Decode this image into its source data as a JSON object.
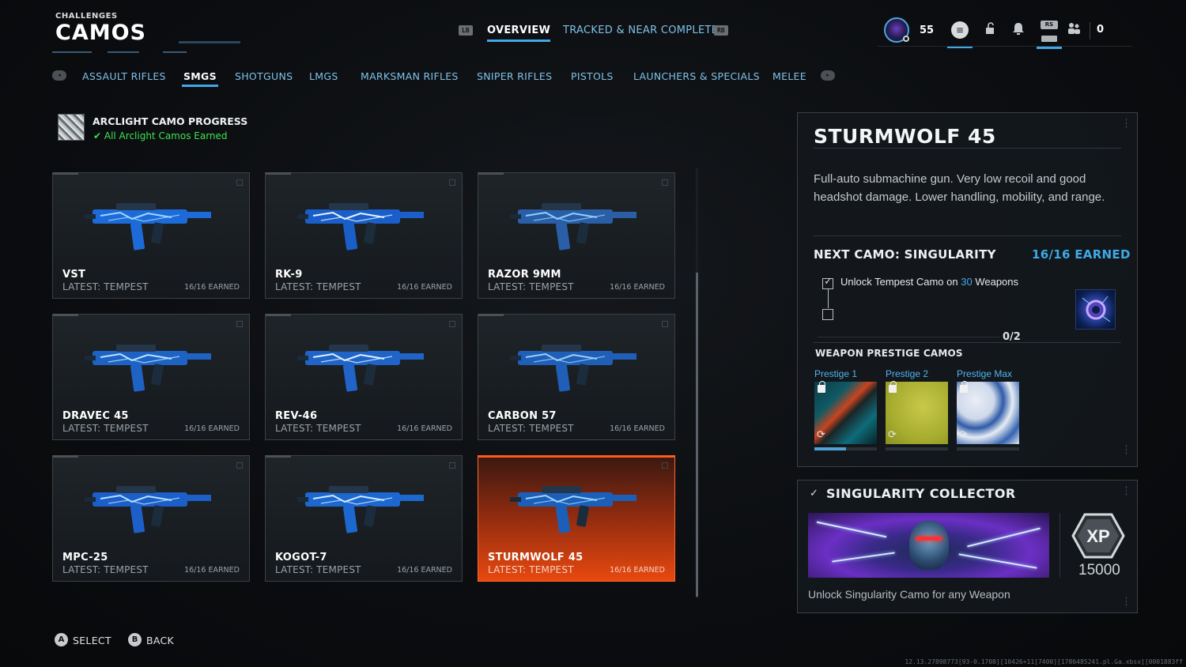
{
  "header": {
    "section": "CHALLENGES",
    "title": "CAMOS",
    "tabs": [
      {
        "label": "OVERVIEW",
        "active": true
      },
      {
        "label": "TRACKED & NEAR COMPLETE",
        "active": false
      }
    ],
    "lb_hint": "LB",
    "rb_hint": "RB",
    "player_level": "55",
    "rs_hint": "RS",
    "notification_count": "0"
  },
  "categories": {
    "items": [
      {
        "label": "ASSAULT RIFLES",
        "active": false
      },
      {
        "label": "SMGS",
        "active": true
      },
      {
        "label": "SHOTGUNS",
        "active": false
      },
      {
        "label": "LMGS",
        "active": false
      },
      {
        "label": "MARKSMAN RIFLES",
        "active": false
      },
      {
        "label": "SNIPER RIFLES",
        "active": false
      },
      {
        "label": "PISTOLS",
        "active": false
      },
      {
        "label": "LAUNCHERS & SPECIALS",
        "active": false
      },
      {
        "label": "MELEE",
        "active": false
      }
    ],
    "left_bumper": "LS",
    "right_bumper": "RS"
  },
  "arclight": {
    "title": "ARCLIGHT CAMO PROGRESS",
    "status": "✔ All Arclight Camos Earned"
  },
  "weapons": [
    {
      "name": "VST",
      "latest": "LATEST: TEMPEST",
      "earned": "16/16 EARNED"
    },
    {
      "name": "RK-9",
      "latest": "LATEST: TEMPEST",
      "earned": "16/16 EARNED"
    },
    {
      "name": "RAZOR 9MM",
      "latest": "LATEST: TEMPEST",
      "earned": "16/16 EARNED"
    },
    {
      "name": "DRAVEC 45",
      "latest": "LATEST: TEMPEST",
      "earned": "16/16 EARNED"
    },
    {
      "name": "REV-46",
      "latest": "LATEST: TEMPEST",
      "earned": "16/16 EARNED"
    },
    {
      "name": "CARBON 57",
      "latest": "LATEST: TEMPEST",
      "earned": "16/16 EARNED"
    },
    {
      "name": "MPC-25",
      "latest": "LATEST: TEMPEST",
      "earned": "16/16 EARNED"
    },
    {
      "name": "KOGOT-7",
      "latest": "LATEST: TEMPEST",
      "earned": "16/16 EARNED"
    },
    {
      "name": "STURMWOLF 45",
      "latest": "LATEST: TEMPEST",
      "earned": "16/16 EARNED"
    }
  ],
  "selected_weapon": "STURMWOLF 45",
  "detail": {
    "title": "STURMWOLF 45",
    "description": "Full-auto submachine gun. Very low recoil and good headshot damage. Lower handling, mobility, and range.",
    "next_camo_label": "NEXT CAMO: SINGULARITY",
    "next_camo_earned": "16/16 EARNED",
    "task_prefix": "Unlock Tempest Camo on",
    "task_number": "30",
    "task_suffix": "Weapons",
    "task_progress": "0/2",
    "prestige_heading": "WEAPON PRESTIGE CAMOS",
    "prestige": [
      {
        "label": "Prestige 1",
        "progress": 0.5
      },
      {
        "label": "Prestige 2",
        "progress": 0
      },
      {
        "label": "Prestige Max",
        "progress": 0
      }
    ]
  },
  "collector": {
    "title": "SINGULARITY COLLECTOR",
    "xp_badge": "XP",
    "xp_amount": "15000",
    "description": "Unlock Singularity Camo for any Weapon"
  },
  "footer": {
    "select_key": "A",
    "select_label": "SELECT",
    "back_key": "B",
    "back_label": "BACK",
    "build": "12.13.27898773[93-0.1708][10426+11[7400][1786485241.pl.Ga.xbsx][0001883ff"
  },
  "colors": {
    "accent_blue": "#3fa9e8",
    "selected_orange": "#e8480f",
    "success_green": "#3ee24f"
  }
}
